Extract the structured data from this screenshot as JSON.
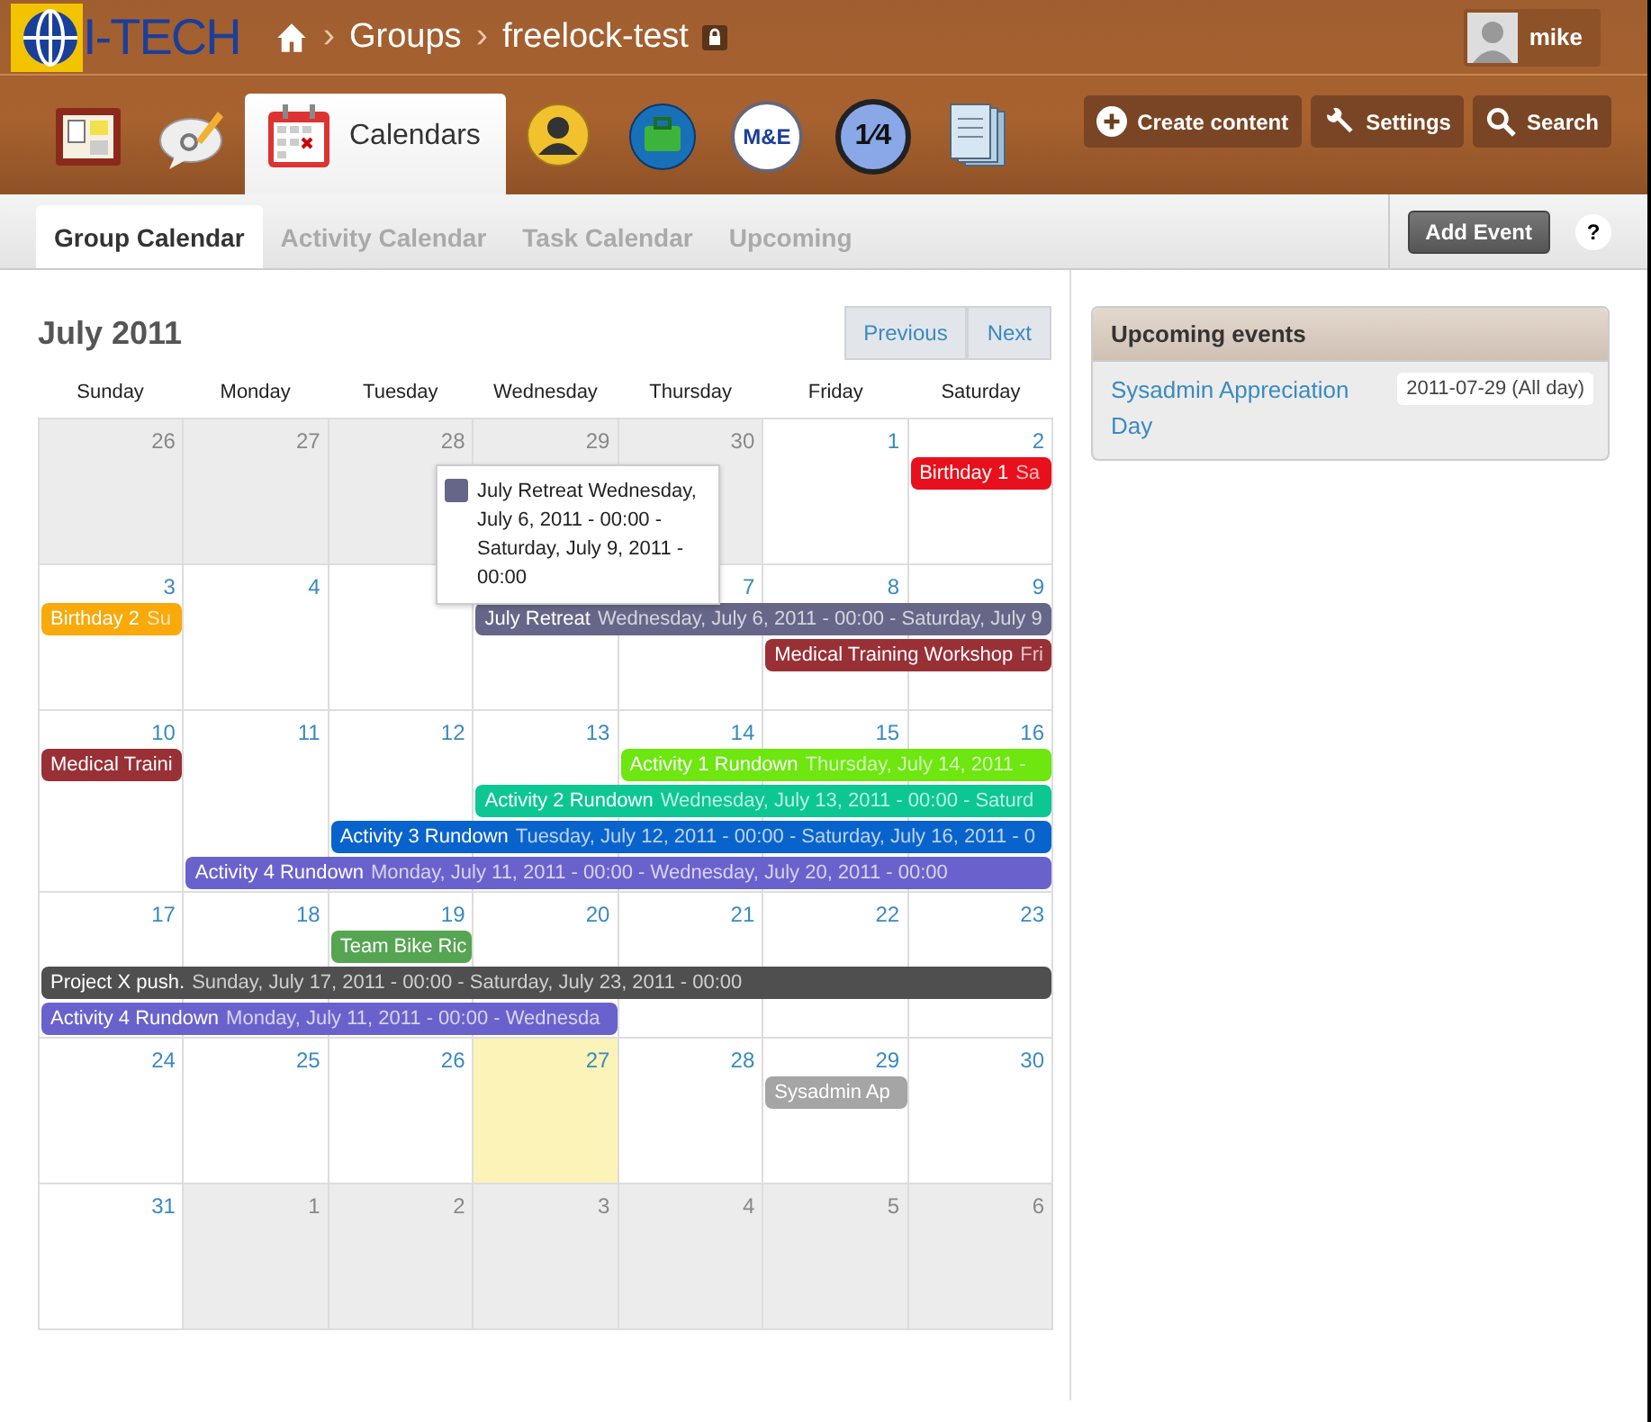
{
  "header": {
    "logo": "I-TECH",
    "separator": "›",
    "breadcrumb": [
      "Groups",
      "freelock-test"
    ],
    "locked": true,
    "user": "mike"
  },
  "app_tabs": [
    {
      "kind": "board",
      "selected": false
    },
    {
      "kind": "chat",
      "selected": false
    },
    {
      "kind": "calendar",
      "label": "Calendars",
      "selected": true
    },
    {
      "kind": "person",
      "selected": false
    },
    {
      "kind": "briefcase",
      "selected": false
    },
    {
      "kind": "badge",
      "text": "M&E",
      "selected": false
    },
    {
      "kind": "badge",
      "text": "1⁄4",
      "selected": false
    },
    {
      "kind": "notebook",
      "selected": false
    }
  ],
  "actions": [
    {
      "kind": "plus",
      "label": "Create content"
    },
    {
      "kind": "wrench",
      "label": "Settings"
    },
    {
      "kind": "search",
      "label": "Search"
    }
  ],
  "sub_tabs": [
    {
      "label": "Group Calendar",
      "selected": true
    },
    {
      "label": "Activity Calendar",
      "selected": false
    },
    {
      "label": "Task Calendar",
      "selected": false
    },
    {
      "label": "Upcoming",
      "selected": false
    }
  ],
  "add_event": "Add Event",
  "help": "?",
  "calendar": {
    "title": "July 2011",
    "prev": "Previous",
    "next": "Next",
    "weekdays": [
      "Sunday",
      "Monday",
      "Tuesday",
      "Wednesday",
      "Thursday",
      "Friday",
      "Saturday"
    ],
    "weeks": [
      {
        "days": [
          {
            "day": "26",
            "other_month": true,
            "today": false
          },
          {
            "day": "27",
            "other_month": true,
            "today": false
          },
          {
            "day": "28",
            "other_month": true,
            "today": false
          },
          {
            "day": "29",
            "other_month": true,
            "today": false
          },
          {
            "day": "30",
            "other_month": true,
            "today": false
          },
          {
            "day": "1",
            "other_month": false,
            "today": false
          },
          {
            "day": "2",
            "other_month": false,
            "today": false
          }
        ],
        "events": [
          {
            "title": "Birthday 1",
            "detail": "Sa",
            "color": "#e8101c"
          }
        ]
      },
      {
        "days": [
          {
            "day": "3",
            "other_month": false,
            "today": false
          },
          {
            "day": "4",
            "other_month": false,
            "today": false
          },
          {
            "other_month": false,
            "today": false
          },
          {
            "other_month": false,
            "today": false
          },
          {
            "day": "7",
            "other_month": false,
            "today": false
          },
          {
            "day": "8",
            "other_month": false,
            "today": false
          },
          {
            "day": "9",
            "other_month": false,
            "today": false
          }
        ],
        "events": [
          {
            "title": "Birthday 2",
            "detail": "Su",
            "color": "#f9a90a"
          },
          {
            "title": "July Retreat",
            "detail": "Wednesday, July 6, 2011 - 00:00 - Saturday, July 9",
            "color": "#666688"
          },
          {
            "title": "Medical Training Workshop",
            "detail": "Fri",
            "color": "#983036"
          }
        ]
      },
      {
        "days": [
          {
            "day": "10",
            "other_month": false,
            "today": false
          },
          {
            "day": "11",
            "other_month": false,
            "today": false
          },
          {
            "day": "12",
            "other_month": false,
            "today": false
          },
          {
            "day": "13",
            "other_month": false,
            "today": false
          },
          {
            "day": "14",
            "other_month": false,
            "today": false
          },
          {
            "day": "15",
            "other_month": false,
            "today": false
          },
          {
            "day": "16",
            "other_month": false,
            "today": false
          }
        ],
        "events": [
          {
            "title": "Medical Traini",
            "color": "#983036"
          },
          {
            "title": "Activity 1 Rundown",
            "detail": "Thursday, July 14, 2011 -",
            "color": "#6ee610"
          },
          {
            "title": "Activity 2 Rundown",
            "detail": "Wednesday, July 13, 2011 - 00:00 - Saturd",
            "color": "#0cc792"
          },
          {
            "title": "Activity 3 Rundown",
            "detail": "Tuesday, July 12, 2011 - 00:00 - Saturday, July 16, 2011 - 0",
            "color": "#0963cc"
          },
          {
            "title": "Activity 4 Rundown",
            "detail": "Monday, July 11, 2011 - 00:00 - Wednesday, July 20, 2011 - 00:00",
            "color": "#6a62cc"
          }
        ]
      },
      {
        "days": [
          {
            "day": "17",
            "other_month": false,
            "today": false
          },
          {
            "day": "18",
            "other_month": false,
            "today": false
          },
          {
            "day": "19",
            "other_month": false,
            "today": false
          },
          {
            "day": "20",
            "other_month": false,
            "today": false
          },
          {
            "day": "21",
            "other_month": false,
            "today": false
          },
          {
            "day": "22",
            "other_month": false,
            "today": false
          },
          {
            "day": "23",
            "other_month": false,
            "today": false
          }
        ],
        "events": [
          {
            "title": "Team Bike Ric",
            "color": "#55a552"
          },
          {
            "title": "Project X push.",
            "detail": "Sunday, July 17, 2011 - 00:00 - Saturday, July 23, 2011 - 00:00",
            "color": "#4f4f4f"
          },
          {
            "title": "Activity 4 Rundown",
            "detail": "Monday, July 11, 2011 - 00:00 - Wednesda",
            "color": "#6a62cc"
          }
        ]
      },
      {
        "days": [
          {
            "day": "24",
            "other_month": false,
            "today": false
          },
          {
            "day": "25",
            "other_month": false,
            "today": false
          },
          {
            "day": "26",
            "other_month": false,
            "today": false
          },
          {
            "day": "27",
            "other_month": false,
            "today": true
          },
          {
            "day": "28",
            "other_month": false,
            "today": false
          },
          {
            "day": "29",
            "other_month": false,
            "today": false
          },
          {
            "day": "30",
            "other_month": false,
            "today": false
          }
        ],
        "events": [
          {
            "title": "Sysadmin Ap",
            "color": "#a5a5a5"
          }
        ]
      },
      {
        "days": [
          {
            "day": "31",
            "other_month": false,
            "today": false
          },
          {
            "day": "1",
            "other_month": true,
            "today": false
          },
          {
            "day": "2",
            "other_month": true,
            "today": false
          },
          {
            "day": "3",
            "other_month": true,
            "today": false
          },
          {
            "day": "4",
            "other_month": true,
            "today": false
          },
          {
            "day": "5",
            "other_month": true,
            "today": false
          },
          {
            "day": "6",
            "other_month": true,
            "today": false
          }
        ]
      }
    ],
    "tooltip": {
      "text": "July Retreat Wednesday, July 6, 2011 - 00:00 - Saturday, July 9, 2011 - 00:00",
      "color": "#666688"
    }
  },
  "upcoming": {
    "title": "Upcoming events",
    "items": [
      {
        "name": "Sysadmin Appreciation Day",
        "when": "2011-07-29 (All day)"
      }
    ]
  }
}
